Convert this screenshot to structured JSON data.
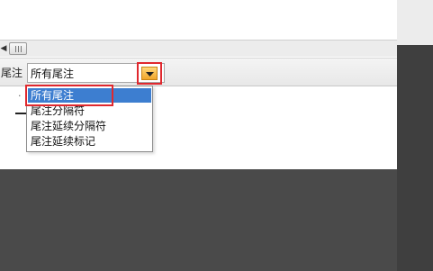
{
  "right_panel": {
    "ghost_text": ""
  },
  "scrollbar": {
    "left_arrow": "◀"
  },
  "endnote_bar": {
    "label": "尾注",
    "selected_value": "所有尾注"
  },
  "dropdown": {
    "items": [
      {
        "label": "所有尾注",
        "selected": true
      },
      {
        "label": "尾注分隔符",
        "selected": false
      },
      {
        "label": "尾注延续分隔符",
        "selected": false
      },
      {
        "label": "尾注延续标记",
        "selected": false
      }
    ]
  },
  "document": {
    "margin_mark": "·"
  },
  "colors": {
    "highlight": "#e0282e",
    "selection": "#3d7ed0",
    "button": "#f0a52a"
  },
  "icons": {
    "dropdown": "chevron-down-icon",
    "scroll_left": "scroll-left-icon"
  }
}
